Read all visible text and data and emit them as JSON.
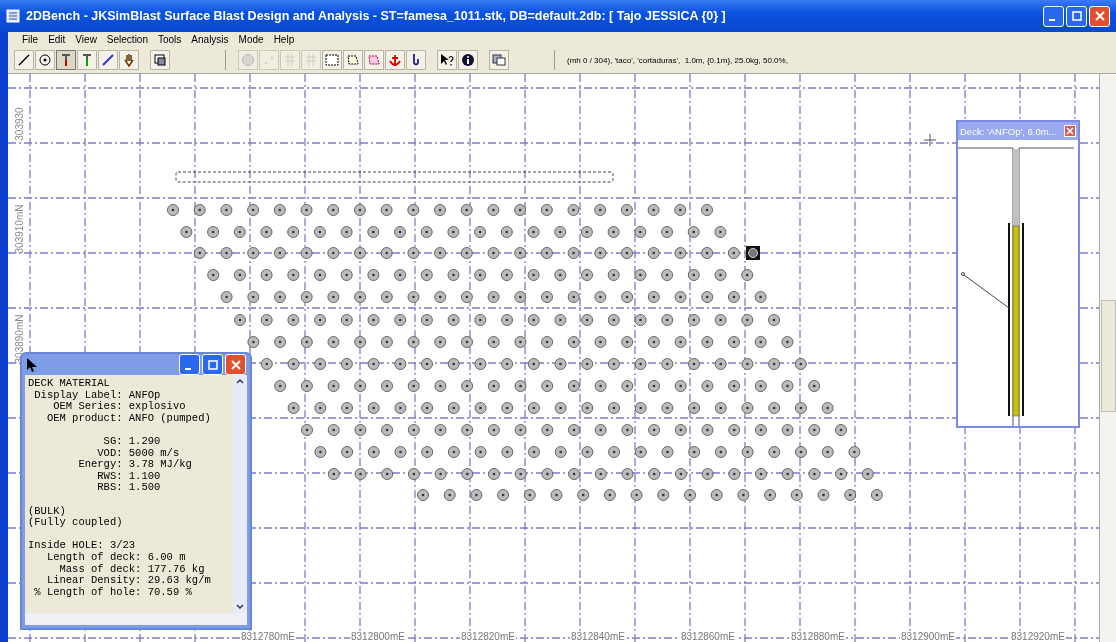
{
  "window": {
    "title": "2DBench - JKSimBlast Surface Blast Design and Analysis - ST=famesa_1011.stk, DB=default.2db: [ Tajo JESSICA {0} ]"
  },
  "menu": [
    "File",
    "Edit",
    "View",
    "Selection",
    "Tools",
    "Analysis",
    "Mode",
    "Help"
  ],
  "toolbar": {
    "status": "(mh 0 / 304), 'taco', 'cortaduras',  1.0m, {0.1m}, 25.0kg, 50.0%,"
  },
  "canvas": {
    "y_labels": [
      "303930",
      "303910mN",
      "303890mN"
    ],
    "x_labels": [
      "8312780mE",
      "8312800mE",
      "8312820mE",
      "8312840mE",
      "8312860mE",
      "8312880mE",
      "8312900mE",
      "8312920mE"
    ]
  },
  "info_window": {
    "blocks": [
      [
        "DECK MATERIAL",
        " Display Label: ANFOp",
        "    OEM Series: explosivo",
        "   OEM product: ANFO (pumped)"
      ],
      [
        "            SG: 1.290",
        "           VOD: 5000 m/s",
        "        Energy: 3.78 MJ/kg",
        "           RWS: 1.100",
        "           RBS: 1.500"
      ],
      [
        "(BULK)",
        "(Fully coupled)"
      ],
      [
        "Inside HOLE: 3/23",
        "   Length of deck: 6.00 m",
        "     Mass of deck: 177.76 kg",
        "   Linear Density: 29.63 kg/m",
        " % Length of hole: 70.59 %"
      ]
    ]
  },
  "deck_window": {
    "title": "Deck: 'ANFOp', 6.0m..."
  }
}
